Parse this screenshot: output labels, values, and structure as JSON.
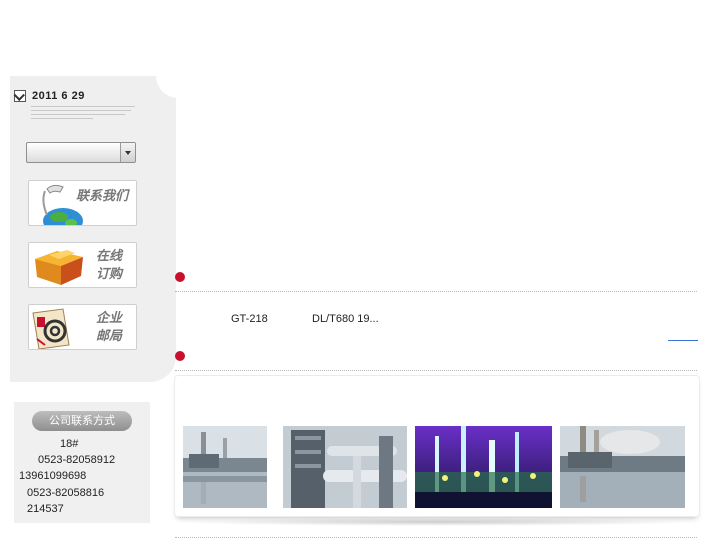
{
  "sidebar": {
    "date": "2011 6 29",
    "select": {
      "value": ""
    },
    "buttons": [
      {
        "label": "联系我们",
        "icon": "globe-telephone-icon"
      },
      {
        "label_line1": "在线",
        "label_line2": "订购",
        "icon": "gift-box-icon"
      },
      {
        "label_line1": "企业",
        "label_line2": "邮局",
        "icon": "email-at-icon"
      }
    ]
  },
  "contact": {
    "title": "公司联系方式",
    "lines": [
      "18#",
      "0523-82058912",
      "13961099698",
      "0523-82058816",
      "214537"
    ]
  },
  "news": {
    "items": [
      "GT-218",
      "DL/T680 19..."
    ]
  },
  "gallery": {
    "photos": [
      {
        "name": "power-plant-chimney"
      },
      {
        "name": "industrial-pipework"
      },
      {
        "name": "refinery-night"
      },
      {
        "name": "power-plant-reflection"
      }
    ]
  },
  "colors": {
    "accent": "#c8102e",
    "link": "#3a73d0",
    "sidebar_bg": "#efefef"
  }
}
